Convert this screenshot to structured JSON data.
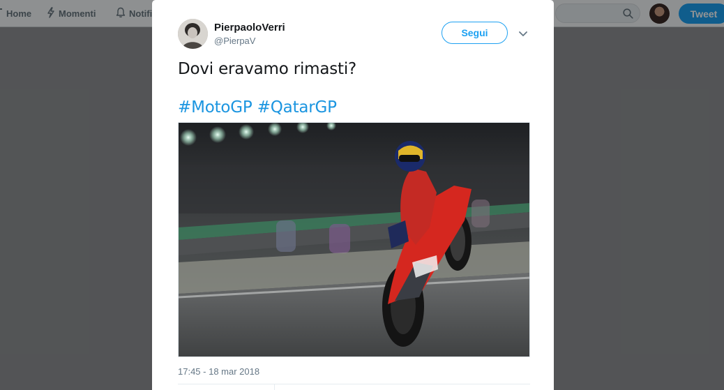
{
  "nav": {
    "home_label": "Home",
    "home_icon": "home-icon",
    "moments_label": "Momenti",
    "moments_icon": "lightning-icon",
    "notifications_label": "Notifi",
    "notifications_icon": "bell-icon",
    "search_icon": "search-icon",
    "tweet_label": "Tweet"
  },
  "tweet": {
    "author_name": "PierpaoloVerri",
    "author_handle": "@PierpaV",
    "follow_label": "Segui",
    "text": "Dovi eravamo rimasti?",
    "hashtags": [
      "#MotoGP",
      "#QatarGP"
    ],
    "timestamp": "17:45 - 18 mar 2018"
  },
  "colors": {
    "accent": "#1da1f2",
    "link": "#1b95e0",
    "text": "#14171a",
    "secondary": "#657786"
  }
}
